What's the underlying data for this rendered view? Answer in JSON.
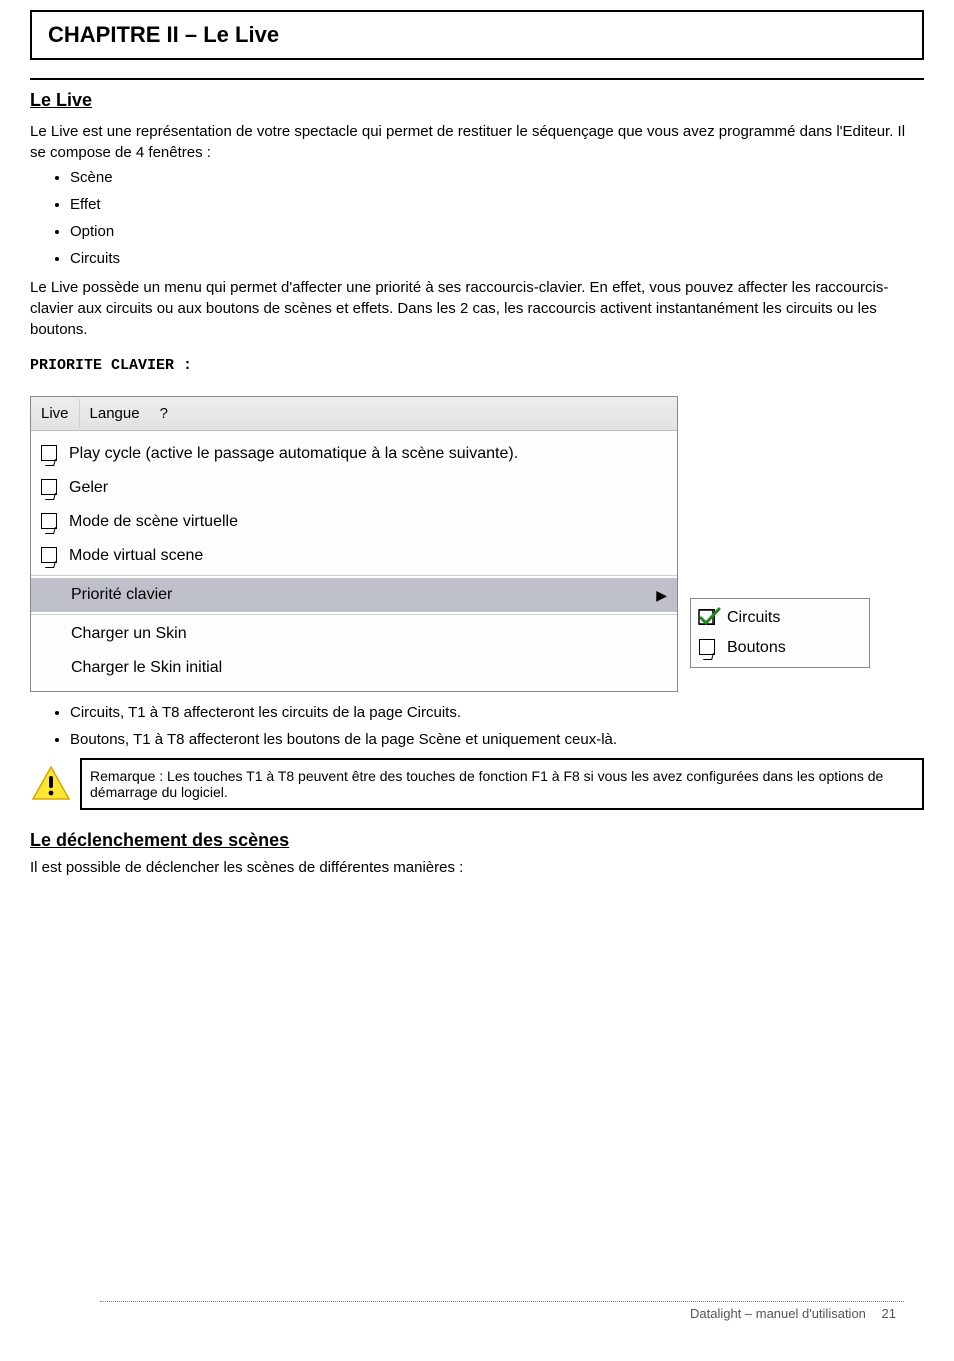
{
  "title": "CHAPITRE II – Le Live",
  "section1_heading": "Le Live",
  "para1": "Le Live est une représentation de votre spectacle qui permet de restituer le séquençage que vous avez programmé dans l'Editeur. Il se compose de 4 fenêtres :",
  "list1": [
    "Scène",
    "Effet",
    "Option",
    "Circuits"
  ],
  "para2": "Le Live possède un menu qui permet d'affecter une priorité à ses raccourcis-clavier. En effet, vous pouvez affecter les raccourcis-clavier aux circuits ou aux boutons de scènes et effets. Dans les 2 cas, les raccourcis activent instantanément les circuits ou les boutons.",
  "para3": "PRIORITE CLAVIER :",
  "menu": {
    "bar": {
      "live": "Live",
      "langue": "Langue",
      "help": "?"
    },
    "items": [
      {
        "label": "Play cycle (active le passage automatique à la scène suivante).",
        "icon": "checkbox-arrow"
      },
      {
        "label": "Geler",
        "icon": "checkbox-arrow"
      },
      {
        "label": "Mode de scène virtuelle",
        "icon": "checkbox-arrow"
      },
      {
        "label": "Mode virtual scene",
        "icon": "checkbox-arrow"
      }
    ],
    "priority": "Priorité clavier",
    "charger_skin": "Charger un Skin",
    "charger_skin_init": "Charger le Skin initial",
    "submenu": {
      "circuits": "Circuits",
      "boutons": "Boutons"
    }
  },
  "list2": [
    "Circuits, T1 à T8 affecteront les circuits de la page Circuits.",
    "Boutons, T1 à T8 affecteront les boutons de la page Scène et uniquement ceux-là."
  ],
  "warning_text": "Remarque : Les touches T1 à T8 peuvent être des touches de fonction F1 à F8 si vous les avez configurées dans les options de démarrage du logiciel.",
  "section2_heading": "Le déclenchement des scènes",
  "para4": "Il est possible de déclencher les scènes de différentes manières :",
  "footer": {
    "product": "Datalight – manuel d'utilisation",
    "page": "21"
  }
}
